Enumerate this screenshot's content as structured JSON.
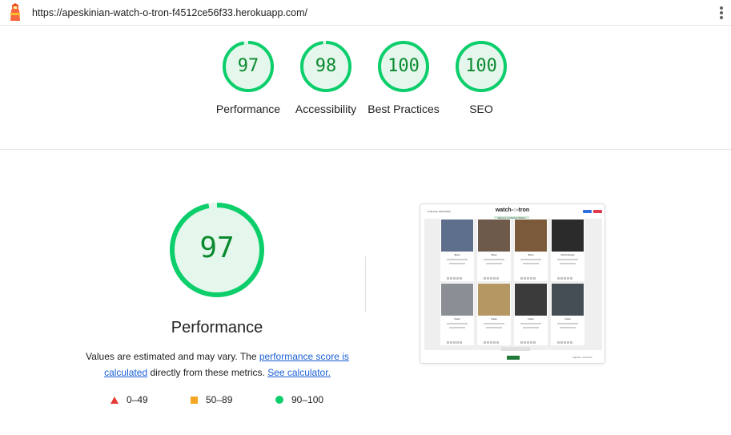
{
  "browser": {
    "url": "https://apeskinian-watch-o-tron-f4512ce56f33.herokuapp.com/",
    "logo_icon": "lighthouse-icon",
    "menu_icon": "kebab-menu-icon"
  },
  "colors": {
    "pass_green": "#0cce6b",
    "pass_text": "#0a8a2f",
    "pass_fill": "#e5f7ec",
    "average_orange": "#f4a623",
    "fail_red": "#e53935",
    "link_blue": "#1a5fd6"
  },
  "scores": [
    {
      "value": 97,
      "label": "Performance"
    },
    {
      "value": 98,
      "label": "Accessibility"
    },
    {
      "value": 100,
      "label": "Best Practices"
    },
    {
      "value": 100,
      "label": "SEO"
    }
  ],
  "performance": {
    "score": 97,
    "title": "Performance",
    "desc_prefix": "Values are estimated and may vary. The ",
    "link_score": "performance score is calculated",
    "desc_middle": " directly from these metrics. ",
    "link_calculator": "See calculator."
  },
  "legend": [
    {
      "icon": "triangle-fail-icon",
      "range": "0–49"
    },
    {
      "icon": "square-average-icon",
      "range": "50–89"
    },
    {
      "icon": "circle-pass-icon",
      "range": "90–100"
    }
  ],
  "thumbnail": {
    "brand": "watch-○-tron",
    "nav_left": "Collection   WATCHES",
    "alert": "Welcome to Collection Widgets",
    "footer": "paginator • apeskinian",
    "cards": [
      {
        "name": "Brew",
        "color": "#5d6f8a"
      },
      {
        "name": "Brew",
        "color": "#6e5a4a"
      },
      {
        "name": "Brew",
        "color": "#7a5a3a"
      },
      {
        "name": "CIGA Design",
        "color": "#2b2b2b"
      },
      {
        "name": "Casio",
        "color": "#8b8f95"
      },
      {
        "name": "Casio",
        "color": "#b49762"
      },
      {
        "name": "Casio",
        "color": "#3b3b3b"
      },
      {
        "name": "Casio",
        "color": "#454d55"
      }
    ]
  }
}
